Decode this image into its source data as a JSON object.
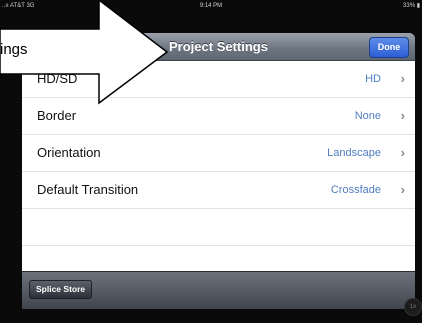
{
  "status_bar": {
    "carrier": "..ıı AT&T 3G",
    "time": "9:14 PM",
    "battery": "33% ▮"
  },
  "callout": {
    "text": "ings"
  },
  "navbar": {
    "title": "Project Settings",
    "done_label": "Done"
  },
  "settings_rows": [
    {
      "label": "HD/SD",
      "value": "HD"
    },
    {
      "label": "Border",
      "value": "None"
    },
    {
      "label": "Orientation",
      "value": "Landscape"
    },
    {
      "label": "Default Transition",
      "value": "Crossfade"
    }
  ],
  "toolbar": {
    "store_label": "Splice Store"
  },
  "corner_badge": "1x",
  "colors": {
    "navbar": "#6f7783",
    "done_button": "#2c5fd6",
    "value_text": "#4f7dc1",
    "panel_background": "#b9bcc2"
  }
}
